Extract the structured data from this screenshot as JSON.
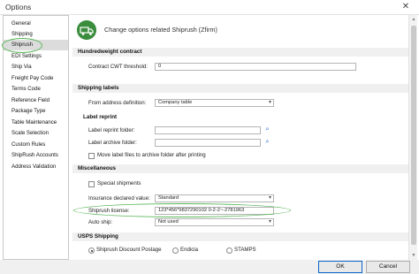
{
  "window": {
    "title": "Options",
    "close_glyph": "✕"
  },
  "sidebar": {
    "items": [
      {
        "label": "General"
      },
      {
        "label": "Shipping"
      },
      {
        "label": "Shiprush"
      },
      {
        "label": "EDI Settings"
      },
      {
        "label": "Ship Via"
      },
      {
        "label": "Freight Pay Code"
      },
      {
        "label": "Terms Code"
      },
      {
        "label": "Reference Field"
      },
      {
        "label": "Package Type"
      },
      {
        "label": "Table Maintenance"
      },
      {
        "label": "Scale Selection"
      },
      {
        "label": "Custom Rules"
      },
      {
        "label": "ShipRush Accounts"
      },
      {
        "label": "Address Validation"
      }
    ],
    "selected": "Shiprush"
  },
  "header": {
    "text": "Change options related Shiprush (Zfirm)",
    "logo_icon": "truck-icon"
  },
  "hundredweight": {
    "title": "Hundredweight contract",
    "cwt_label": "Contract CWT threshold:",
    "cwt_value": "0"
  },
  "shipping_labels": {
    "title": "Shipping labels",
    "from_address_label": "From address definition:",
    "from_address_value": "Company table"
  },
  "label_reprint": {
    "title": "Label reprint",
    "reprint_folder_label": "Label reprint folder:",
    "reprint_folder_value": "",
    "archive_folder_label": "Label archive folder:",
    "archive_folder_value": "",
    "move_files_label": "Move label files to archive folder after printing",
    "move_files_checked": false,
    "browse_icon": "search-icon"
  },
  "misc": {
    "title": "Miscellaneous",
    "special_shipments_label": "Special shipments",
    "special_shipments_checked": false,
    "insurance_label": "Insurance declared value:",
    "insurance_value": "Standard",
    "license_label": "Shiprush license:",
    "license_value": "123*456*9837290102 0-2-2~-2781963",
    "auto_ship_label": "Auto ship:",
    "auto_ship_value": "Not used"
  },
  "usps": {
    "title": "USPS Shipping",
    "options": [
      {
        "label": "Shiprush Discount Postage",
        "selected": true
      },
      {
        "label": "Endicia",
        "selected": false
      },
      {
        "label": "STAMPS",
        "selected": false
      }
    ]
  },
  "footer": {
    "ok_label": "OK",
    "cancel_label": "Cancel"
  },
  "colors": {
    "highlight_oval": "#5cb85c",
    "logo_green": "#3b8d3e",
    "primary_border": "#0a64c8"
  }
}
